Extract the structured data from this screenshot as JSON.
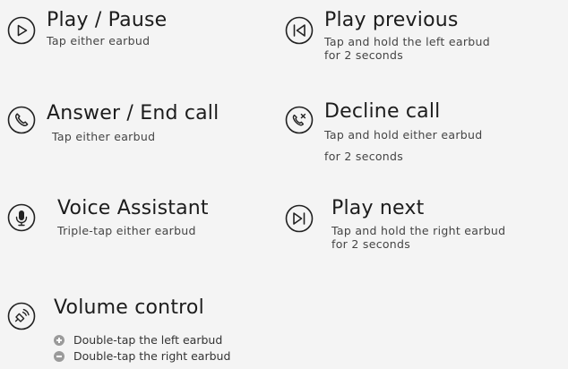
{
  "controls": [
    {
      "id": "play-pause",
      "title": "Play / Pause",
      "desc": [
        "Tap either earbud"
      ],
      "icon": "play-icon"
    },
    {
      "id": "play-previous",
      "title": "Play previous",
      "desc": [
        "Tap and hold the left earbud",
        "for 2 seconds"
      ],
      "icon": "skip-back-icon"
    },
    {
      "id": "answer-end-call",
      "title": "Answer / End call",
      "desc": [
        "Tap either earbud"
      ],
      "icon": "phone-icon"
    },
    {
      "id": "decline-call",
      "title": "Decline call",
      "desc": [
        "Tap and hold either earbud",
        "for 2 seconds"
      ],
      "icon": "phone-decline-icon"
    },
    {
      "id": "voice-assistant",
      "title": "Voice Assistant",
      "desc": [
        "Triple-tap either earbud"
      ],
      "icon": "microphone-icon"
    },
    {
      "id": "play-next",
      "title": "Play next",
      "desc": [
        "Tap and hold the right earbud",
        "for 2 seconds"
      ],
      "icon": "skip-forward-icon"
    },
    {
      "id": "volume-control",
      "title": "Volume control",
      "icon": "speaker-icon"
    }
  ],
  "volume": {
    "up": "Double-tap the left earbud",
    "down": "Double-tap the right earbud"
  },
  "colors": {
    "background": "#f4f4f4",
    "text": "#222222",
    "icon_stroke": "#222222",
    "bullet": "#9a9a9a"
  }
}
